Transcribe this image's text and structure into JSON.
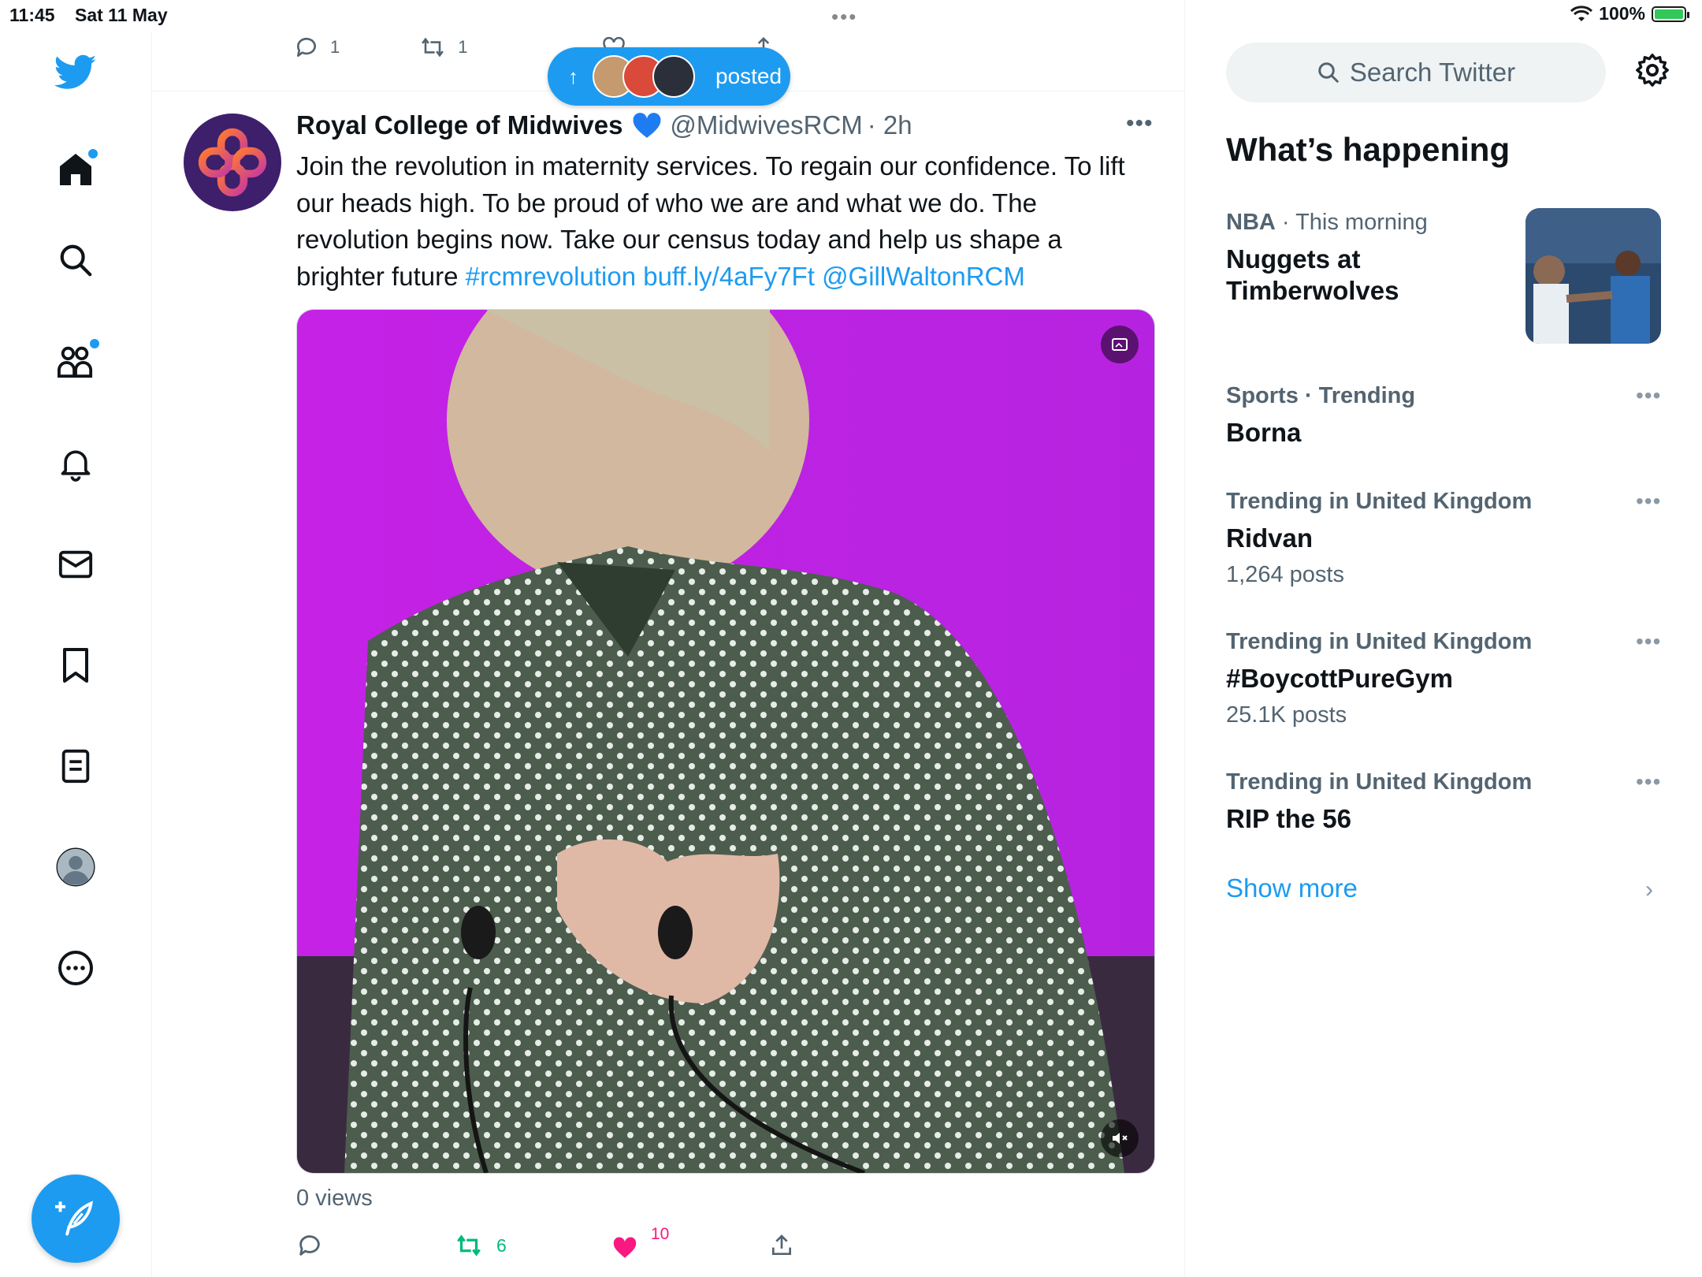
{
  "status_bar": {
    "time": "11:45",
    "date": "Sat 11 May",
    "battery": "100%",
    "battery_level": 1.0
  },
  "nav": {
    "items": [
      "twitter-logo",
      "home-icon",
      "search-icon",
      "communities-icon",
      "notifications-icon",
      "messages-icon",
      "bookmarks-icon",
      "lists-icon",
      "profile-icon",
      "more-icon"
    ],
    "compose": "compose-icon"
  },
  "previous_tweet": {
    "replies": "1",
    "retweets": "1"
  },
  "new_posts_pill": {
    "label": "posted"
  },
  "tweet": {
    "name": "Royal College of Midwives",
    "handle": "@MidwivesRCM",
    "time": "· 2h",
    "text": "Join the revolution in maternity services. To regain our confidence. To lift our heads high. To be proud of who we are and what we do. The revolution begins now. Take our census today and help us shape a brighter future",
    "hashtag": "#rcmrevolution",
    "url": "buff.ly/4aFy7Ft",
    "mention": "@GillWaltonRCM",
    "views": "0 views",
    "retweets": "6",
    "likes": "10"
  },
  "sidebar": {
    "search_placeholder": "Search Twitter",
    "heading": "What’s happening",
    "trends": [
      {
        "category": "NBA",
        "meta": " · This morning",
        "title": "Nuggets at Timberwolves",
        "count": ""
      },
      {
        "category": "Sports · Trending",
        "meta": "",
        "title": "Borna",
        "count": ""
      },
      {
        "category": "Trending in United Kingdom",
        "meta": "",
        "title": "Ridvan",
        "count": "1,264 posts"
      },
      {
        "category": "Trending in United Kingdom",
        "meta": "",
        "title": "#BoycottPureGym",
        "count": "25.1K posts"
      },
      {
        "category": "Trending in United Kingdom",
        "meta": "",
        "title": "RIP the 56",
        "count": ""
      }
    ],
    "show_more": "Show more"
  },
  "colors": {
    "brand": "#1d9bf0",
    "like": "#f91880",
    "retweet": "#00ba7c",
    "secondary_text": "#536471"
  }
}
